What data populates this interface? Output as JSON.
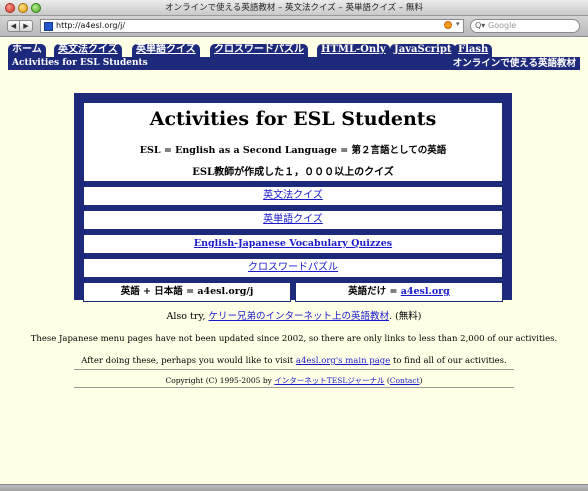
{
  "window": {
    "title": "オンラインで使える英語教材 – 英文法クイズ – 英単語クイズ – 無料"
  },
  "toolbar": {
    "back_glyph": "◀",
    "forward_glyph": "▶",
    "url": "http://a4esl.org/j/",
    "search_placeholder": "Google",
    "search_glyph": "Q▾",
    "go_glyph": "▾"
  },
  "site_nav": {
    "tabs": [
      {
        "label": "ホーム"
      },
      {
        "label": "英文法クイズ"
      },
      {
        "label": "英単語クイズ"
      },
      {
        "label": "クロスワードパズル"
      },
      {
        "label": "HTML-Only"
      },
      {
        "label": "JavaScript"
      },
      {
        "label": "Flash"
      }
    ],
    "banner_left": "Activities for ESL Students",
    "banner_right": "オンラインで使える英語教材"
  },
  "main_box": {
    "title": "Activities for ESL Students",
    "subtitle": "ESL = English as a Second Language = 第２言語としての英語",
    "tagline": "ESL教師が作成した１，０００以上のクイズ",
    "links": [
      {
        "label": "英文法クイズ"
      },
      {
        "label": "英単語クイズ"
      },
      {
        "label": "English-Japanese Vocabulary Quizzes"
      },
      {
        "label": "クロスワードパズル"
      }
    ],
    "bottom_left": "英語 + 日本語 = a4esl.org/j",
    "bottom_right_prefix": "英語だけ = ",
    "bottom_right_link": "a4esl.org"
  },
  "footer": {
    "also_prefix": "Also try, ",
    "also_link": "ケリー兄弟のインターネット上の英語教材",
    "also_suffix": ". (無料)",
    "notice": "These Japanese menu pages have not been updated since 2002, so there are only links to less than 2,000 of our activities.",
    "after_prefix": "After doing these, perhaps you would like to visit ",
    "after_link": "a4esl.org's main page",
    "after_suffix": " to find all of our activities.",
    "copyright_prefix": "Copyright (C) 1995-2005 by ",
    "copyright_link": "インターネットTESLジャーナル",
    "copyright_contact": "Contact"
  }
}
